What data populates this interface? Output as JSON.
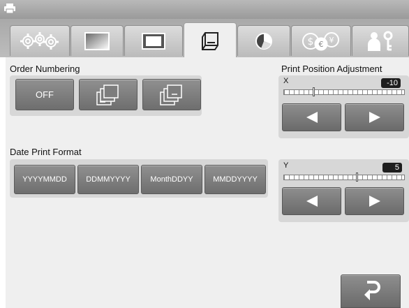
{
  "tabs": [
    {
      "icon": "gears-icon"
    },
    {
      "icon": "gradient-frame-icon"
    },
    {
      "icon": "border-frame-icon"
    },
    {
      "icon": "paper-tray-icon",
      "active": true
    },
    {
      "icon": "pie-chart-icon"
    },
    {
      "icon": "currency-icon"
    },
    {
      "icon": "person-key-icon"
    }
  ],
  "order_numbering": {
    "label": "Order Numbering",
    "off_label": "OFF"
  },
  "date_print_format": {
    "label": "Date Print Format",
    "options": [
      "YYYYMMDD",
      "DDMMYYYY",
      "MonthDDYY",
      "MMDDYYYY"
    ]
  },
  "print_position": {
    "label": "Print Position Adjustment",
    "x": {
      "label": "X",
      "value": "-10",
      "level": -10
    },
    "y": {
      "label": "Y",
      "value": "5",
      "level": 5
    }
  },
  "colors": {
    "button": "#7d7d7d",
    "panel": "#efefef",
    "group": "#d7d7d7",
    "value_badge": "#1e1e1e"
  }
}
